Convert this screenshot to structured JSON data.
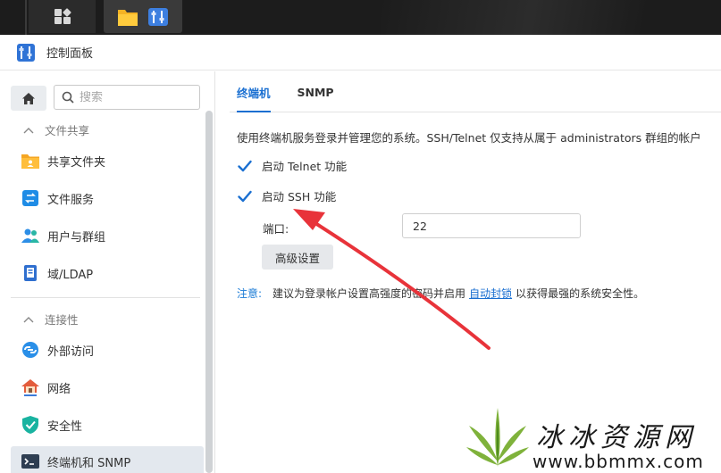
{
  "window": {
    "title": "控制面板"
  },
  "sidebar": {
    "search_placeholder": "搜索",
    "groups": [
      {
        "label": "文件共享",
        "items": [
          "共享文件夹",
          "文件服务",
          "用户与群组",
          "域/LDAP"
        ]
      },
      {
        "label": "连接性",
        "items": [
          "外部访问",
          "网络",
          "安全性",
          "终端机和 SNMP"
        ]
      }
    ],
    "active_item": "终端机和 SNMP"
  },
  "main": {
    "tabs": [
      "终端机",
      "SNMP"
    ],
    "active_tab": "终端机",
    "description": "使用终端机服务登录并管理您的系统。SSH/Telnet 仅支持从属于 administrators 群组的帐户",
    "telnet_label": "启动 Telnet 功能",
    "telnet_checked": true,
    "ssh_label": "启动 SSH 功能",
    "ssh_checked": true,
    "port_label": "端口:",
    "port_value": "22",
    "advanced_button": "高级设置",
    "note_label": "注意:",
    "note_text_before": "建议为登录帐户设置高强度的密码并启用",
    "note_link": "自动封锁",
    "note_text_after": "以获得最强的系统安全性。"
  },
  "watermark": {
    "text": "冰冰资源网",
    "url": "www.bbmmx.com"
  },
  "colors": {
    "accent": "#1a6fd1",
    "annotation": "#e8333a"
  }
}
